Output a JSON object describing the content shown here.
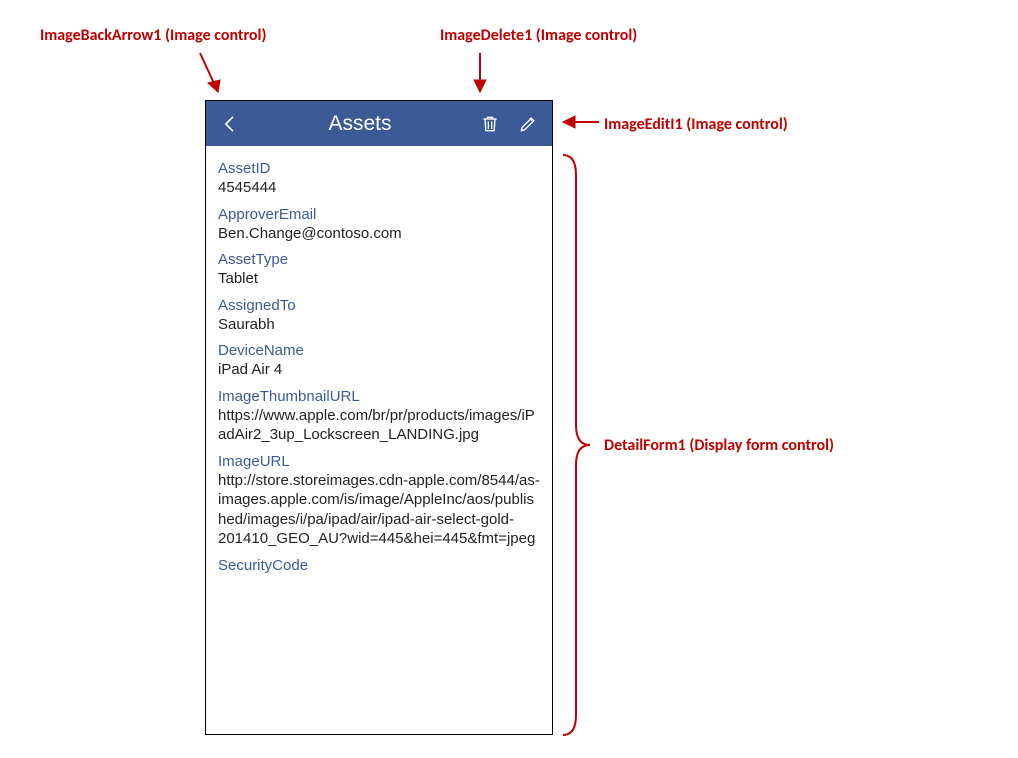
{
  "annotations": {
    "backArrow": "ImageBackArrow1 (Image control)",
    "delete": "ImageDelete1 (Image control)",
    "edit": "ImageEditI1 (Image control)",
    "detailForm": "DetailForm1 (Display form control)"
  },
  "header": {
    "title": "Assets"
  },
  "fields": {
    "assetId": {
      "label": "AssetID",
      "value": "4545444"
    },
    "approverEmail": {
      "label": "ApproverEmail",
      "value": "Ben.Change@contoso.com"
    },
    "assetType": {
      "label": "AssetType",
      "value": "Tablet"
    },
    "assignedTo": {
      "label": "AssignedTo",
      "value": "Saurabh"
    },
    "deviceName": {
      "label": "DeviceName",
      "value": "iPad Air 4"
    },
    "imageThumbnailUrl": {
      "label": "ImageThumbnailURL",
      "value": "https://www.apple.com/br/pr/products/images/iPadAir2_3up_Lockscreen_LANDING.jpg"
    },
    "imageUrl": {
      "label": "ImageURL",
      "value": "http://store.storeimages.cdn-apple.com/8544/as-images.apple.com/is/image/AppleInc/aos/published/images/i/pa/ipad/air/ipad-air-select-gold-201410_GEO_AU?wid=445&hei=445&fmt=jpeg"
    },
    "securityCode": {
      "label": "SecurityCode",
      "value": ""
    }
  }
}
